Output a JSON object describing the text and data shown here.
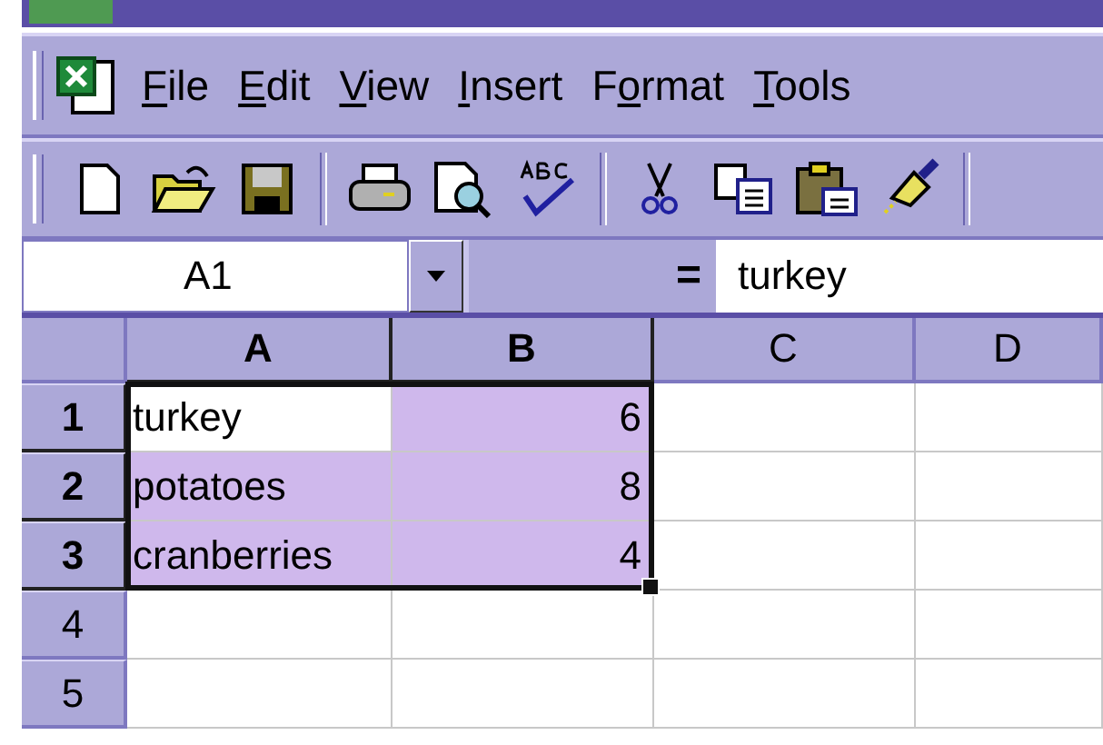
{
  "menu": [
    {
      "key": "F",
      "rest": "ile"
    },
    {
      "key": "E",
      "rest": "dit"
    },
    {
      "key": "V",
      "rest": "iew"
    },
    {
      "key": "I",
      "rest": "nsert"
    },
    {
      "before": "F",
      "key": "o",
      "rest": "rmat"
    },
    {
      "key": "T",
      "rest": "ools"
    }
  ],
  "toolbar": [
    {
      "kind": "new"
    },
    {
      "kind": "open"
    },
    {
      "kind": "save"
    },
    {
      "kind": "sep"
    },
    {
      "kind": "print"
    },
    {
      "kind": "preview"
    },
    {
      "kind": "spell"
    },
    {
      "kind": "sep"
    },
    {
      "kind": "cut"
    },
    {
      "kind": "copy"
    },
    {
      "kind": "paste"
    },
    {
      "kind": "painter"
    },
    {
      "kind": "sep"
    }
  ],
  "formula_bar": {
    "name_box": "A1",
    "equals": "=",
    "value": "turkey"
  },
  "columns": [
    {
      "label": "A",
      "selected": true
    },
    {
      "label": "B",
      "selected": true
    },
    {
      "label": "C",
      "selected": false
    },
    {
      "label": "D",
      "selected": false
    }
  ],
  "rows": [
    {
      "label": "1",
      "selected": true,
      "cells": [
        {
          "value": "turkey",
          "kind": "text",
          "active": true
        },
        {
          "value": "6",
          "kind": "number",
          "selected": true
        },
        {
          "selected": false
        },
        {
          "selected": false
        }
      ]
    },
    {
      "label": "2",
      "selected": true,
      "cells": [
        {
          "value": "potatoes",
          "kind": "text",
          "selected": true
        },
        {
          "value": "8",
          "kind": "number",
          "selected": true
        },
        {
          "selected": false
        },
        {
          "selected": false
        }
      ]
    },
    {
      "label": "3",
      "selected": true,
      "cells": [
        {
          "value": "cranberries",
          "kind": "text",
          "selected": true
        },
        {
          "value": "4",
          "kind": "number",
          "selected": true
        },
        {
          "selected": false
        },
        {
          "selected": false
        }
      ]
    },
    {
      "label": "4",
      "selected": false,
      "cells": [
        {
          "selected": false
        },
        {
          "selected": false
        },
        {
          "selected": false
        },
        {
          "selected": false
        }
      ]
    },
    {
      "label": "5",
      "selected": false,
      "cells": [
        {
          "selected": false
        },
        {
          "selected": false
        },
        {
          "selected": false
        },
        {
          "selected": false
        }
      ]
    }
  ]
}
